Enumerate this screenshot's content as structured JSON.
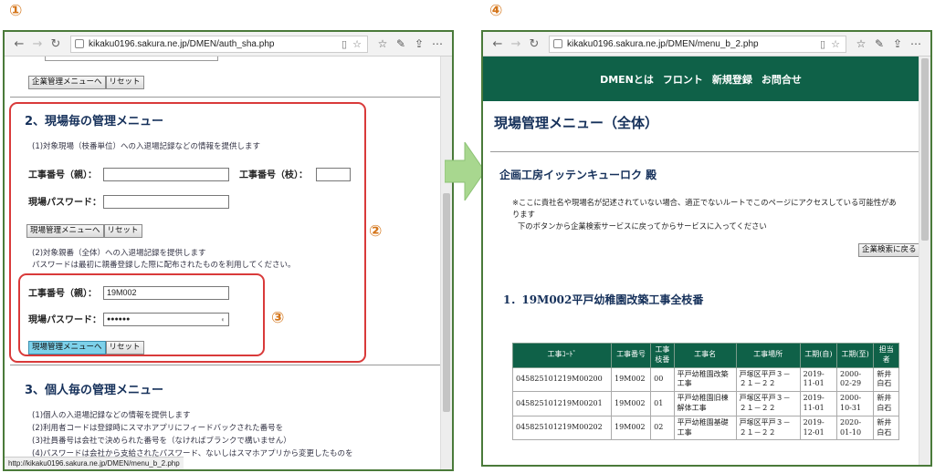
{
  "labels": {
    "one": "①",
    "two": "②",
    "three": "③",
    "four": "④"
  },
  "left": {
    "url": "kikaku0196.sakura.ne.jp/DMEN/auth_sha.php",
    "buttons_top": {
      "menu": "企業管理メニューへ",
      "reset": "リセット"
    },
    "section2": {
      "title": "2、現場毎の管理メニュー",
      "desc1": "(1)対象現場（枝番単位）への入退場記録などの情報を提供します",
      "label_parent": "工事番号（親）：",
      "label_branch": "工事番号（枝）：",
      "label_password": "現場パスワード：",
      "btn_menu": "現場管理メニューへ",
      "btn_reset": "リセット",
      "desc2a": "(2)対象親番（全体）への入退場記録を提供します",
      "desc2b": "パスワードは最初に親番登録した際に配布されたものを利用してください。",
      "label_parent2": "工事番号（親）：",
      "value_parent2": "19M002",
      "label_password2": "現場パスワード：",
      "value_password2": "●●●●●●",
      "btn_menu2": "現場管理メニューへ",
      "btn_reset2": "リセット"
    },
    "section3": {
      "title": "3、個人毎の管理メニュー",
      "lines": [
        "(1)個人の入退場記録などの情報を提供します",
        "(2)利用者コードは登録時にスマホアプリにフィードバックされた番号を",
        "(3)社員番号は会社で決められた番号を（なければブランクで構いません）",
        "(4)パスワードは会社から支給されたパスワード、ないしはスマホアプリから変更したものを"
      ]
    },
    "status": "http://kikaku0196.sakura.ne.jp/DMEN/menu_b_2.php"
  },
  "right": {
    "url": "kikaku0196.sakura.ne.jp/DMEN/menu_b_2.php",
    "nav": [
      "DMENとは",
      "フロント",
      "新規登録",
      "お問合せ"
    ],
    "page_title": "現場管理メニュー（全体）",
    "company": "企画工房イッテンキューロク 殿",
    "notice1": "※ここに貴社名や現場名が記述されていない場合、適正でないルートでこのページにアクセスしている可能性があ",
    "notice2": "ります",
    "notice3": "下のボタンから企業検索サービスに戻ってからサービスに入ってください",
    "back_button": "企業検索に戻る",
    "project_heading": "1．19M002平戸幼稚園改築工事全枝番",
    "table": {
      "headers": [
        "工事ｺｰﾄﾞ",
        "工事番号",
        "工事枝番",
        "工事名",
        "工事場所",
        "工期(自)",
        "工期(至)",
        "担当者"
      ],
      "rows": [
        [
          "045825101219M00200",
          "19M002",
          "00",
          "平戸幼稚園改築工事",
          "戸塚区平戸３－２１－２２",
          "2019-11-01",
          "2000-02-29",
          "新井白石"
        ],
        [
          "045825101219M00201",
          "19M002",
          "01",
          "平戸幼稚園旧棟解体工事",
          "戸塚区平戸３－２１－２２",
          "2019-11-01",
          "2000-10-31",
          "新井白石"
        ],
        [
          "045825101219M00202",
          "19M002",
          "02",
          "平戸幼稚園基礎工事",
          "戸塚区平戸３－２１－２２",
          "2019-12-01",
          "2020-01-10",
          "新井白石"
        ]
      ]
    }
  },
  "colors": {
    "accent_orange": "#d4751a",
    "frame_green": "#4a7a3a",
    "header_green": "#0f6148",
    "highlight_red": "#d93a3a"
  }
}
